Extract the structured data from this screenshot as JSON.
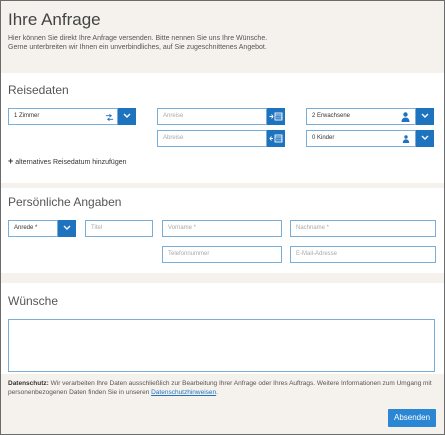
{
  "page": {
    "title": "Ihre Anfrage",
    "intro_line1": "Hier können Sie direkt Ihre Anfrage versenden. Bitte nennen Sie uns Ihre Wünsche.",
    "intro_line2": "Gerne unterbreiten wir Ihnen ein unverbindliches, auf Sie zugeschnittenes Angebot."
  },
  "reisedaten": {
    "title": "Reisedaten",
    "room_select": "1 Zimmer",
    "anreise_placeholder": "Anreise",
    "abreise_placeholder": "Abreise",
    "adults_select": "2 Erwachsene",
    "children_select": "0 Kinder",
    "add_date_link": "alternatives Reisedatum hinzufügen",
    "add_symbol": "+"
  },
  "personal": {
    "title": "Persönliche Angaben",
    "anrede_select": "Anrede *",
    "titel_placeholder": "Titel",
    "vorname_placeholder": "Vorname *",
    "nachname_placeholder": "Nachname *",
    "telefon_placeholder": "Telefonnummer",
    "email_placeholder": "E-Mail-Adresse"
  },
  "wishes": {
    "title": "Wünsche"
  },
  "disclaimer": {
    "label": "Datenschutz:",
    "text": " Wir verarbeiten Ihre Daten ausschließlich zur Bearbeitung Ihrer Anfrage oder Ihres Auftrags. Weitere Informationen zum Umgang mit personenbezogenen Daten finden Sie in unseren ",
    "link": "Datenschutzhinweisen",
    "end": "."
  },
  "submit_label": "Absenden",
  "colors": {
    "accent": "#1e73be",
    "field_border": "#7aaed8",
    "background": "#f5f2ed"
  }
}
